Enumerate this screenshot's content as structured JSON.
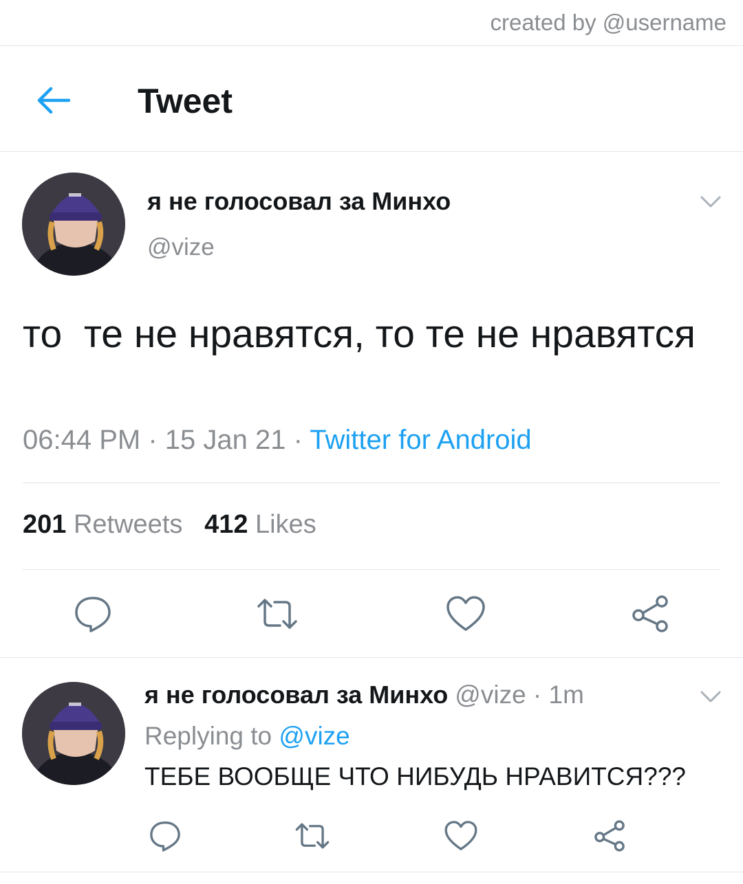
{
  "watermark": {
    "credit": "created by @username"
  },
  "header": {
    "title": "Tweet",
    "back_icon": "arrow-left-icon",
    "accent_color": "#1da1f2"
  },
  "tweet": {
    "author_name": "я не голосовал за Минхо",
    "handle": "@vize",
    "text": "то  те не нравятся, то те не нравятся",
    "time": "06:44 PM",
    "separator": " · ",
    "date": "15 Jan 21",
    "source": "Twitter for Android",
    "retweets_count": "201",
    "retweets_label": "Retweets",
    "likes_count": "412",
    "likes_label": "Likes",
    "actions": [
      "reply-icon",
      "retweet-icon",
      "like-icon",
      "share-icon"
    ]
  },
  "reply": {
    "author_name": "я не голосовал за Минхо",
    "handle": "@vize",
    "dot": " · ",
    "time": "1m",
    "replying_label": "Replying to ",
    "replying_handle": "@vize",
    "text": "ТЕБЕ ВООБЩЕ ЧТО НИБУДЬ НРАВИТСЯ???"
  },
  "colors": {
    "text": "#14171a",
    "secondary": "#8a8d91",
    "divider": "#e1e4e8",
    "link": "#1da1f2"
  }
}
